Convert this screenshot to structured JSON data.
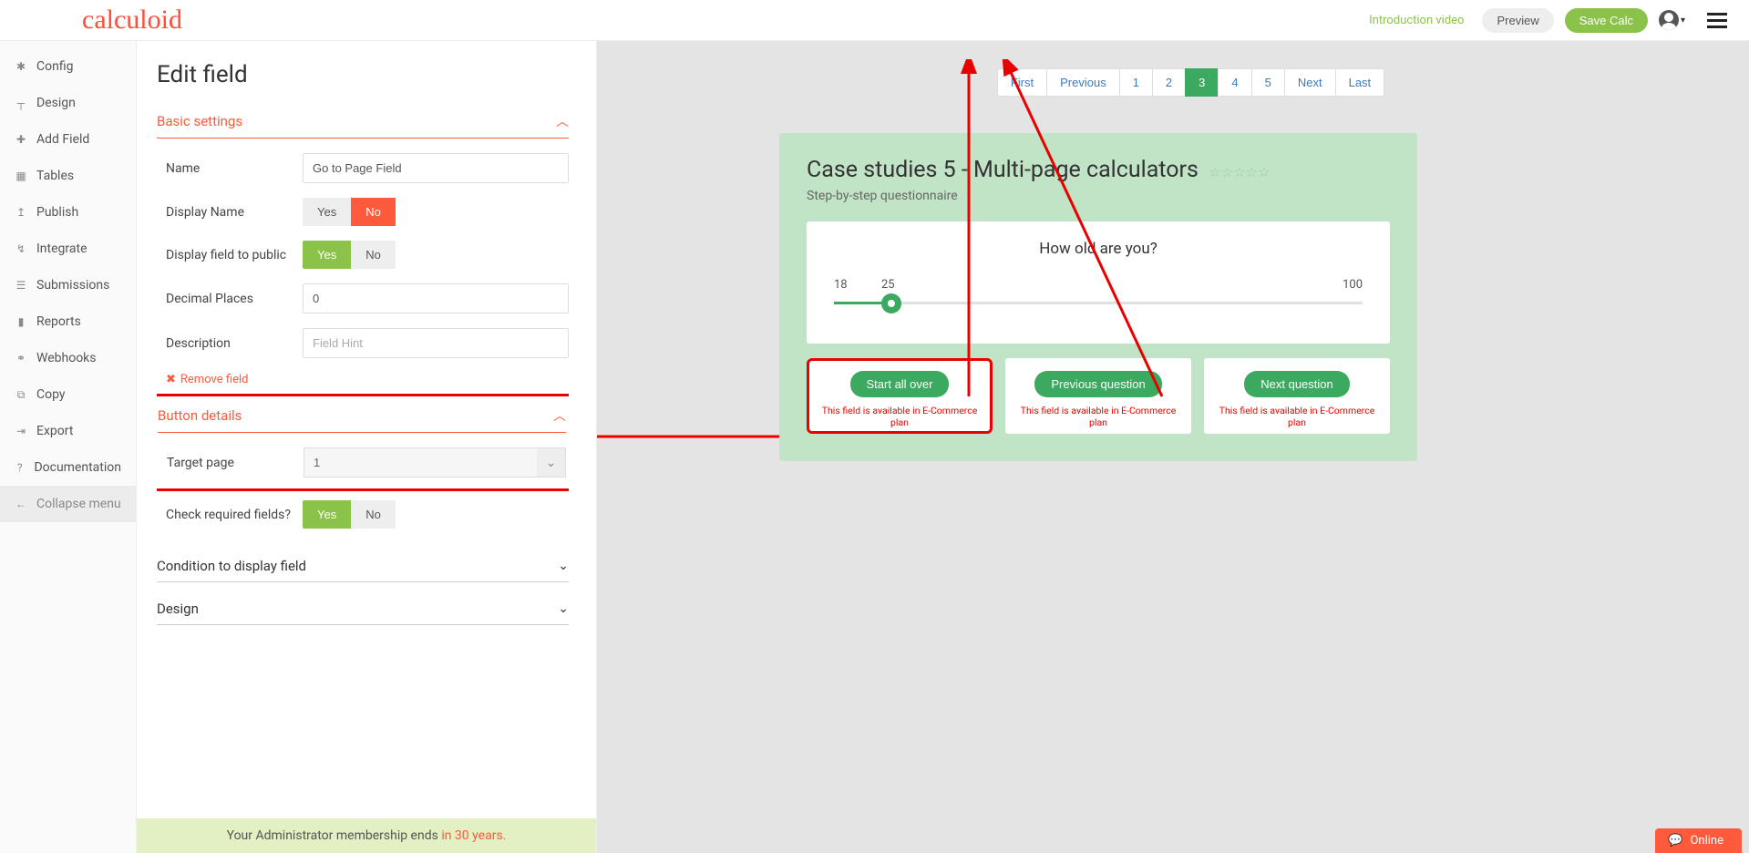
{
  "header": {
    "logo": "calculoid",
    "intro_link": "Introduction video",
    "preview_btn": "Preview",
    "save_btn": "Save Calc"
  },
  "sidebar": {
    "items": [
      {
        "icon": "gear",
        "label": "Config"
      },
      {
        "icon": "design",
        "label": "Design"
      },
      {
        "icon": "plus",
        "label": "Add Field"
      },
      {
        "icon": "table",
        "label": "Tables"
      },
      {
        "icon": "publish",
        "label": "Publish"
      },
      {
        "icon": "integrate",
        "label": "Integrate"
      },
      {
        "icon": "submissions",
        "label": "Submissions"
      },
      {
        "icon": "reports",
        "label": "Reports"
      },
      {
        "icon": "webhooks",
        "label": "Webhooks"
      },
      {
        "icon": "copy",
        "label": "Copy"
      },
      {
        "icon": "export",
        "label": "Export"
      },
      {
        "icon": "docs",
        "label": "Documentation"
      },
      {
        "icon": "collapse",
        "label": "Collapse menu"
      }
    ]
  },
  "edit": {
    "title": "Edit field",
    "basic_settings": "Basic settings",
    "name_label": "Name",
    "name_value": "Go to Page Field",
    "display_name_label": "Display Name",
    "display_public_label": "Display field to public",
    "decimal_label": "Decimal Places",
    "decimal_value": "0",
    "description_label": "Description",
    "description_placeholder": "Field Hint",
    "remove_field": "Remove field",
    "button_details": "Button details",
    "target_page_label": "Target page",
    "target_page_value": "1",
    "check_required_label": "Check required fields?",
    "condition_section": "Condition to display field",
    "design_section": "Design",
    "yes": "Yes",
    "no": "No"
  },
  "pagination": {
    "first": "First",
    "previous": "Previous",
    "p1": "1",
    "p2": "2",
    "p3": "3",
    "p4": "4",
    "p5": "5",
    "next": "Next",
    "last": "Last"
  },
  "calc": {
    "title": "Case studies 5 - Multi-page calculators",
    "subtitle": "Step-by-step questionnaire",
    "question": "How old are you?",
    "min": "18",
    "val": "25",
    "max": "100",
    "btn_start": "Start all over",
    "btn_prev": "Previous question",
    "btn_next": "Next question",
    "plan_note": "This field is available in E-Commerce plan"
  },
  "footer": {
    "text": "Your Administrator membership ends ",
    "accent": "in 30 years."
  },
  "online": "Online"
}
